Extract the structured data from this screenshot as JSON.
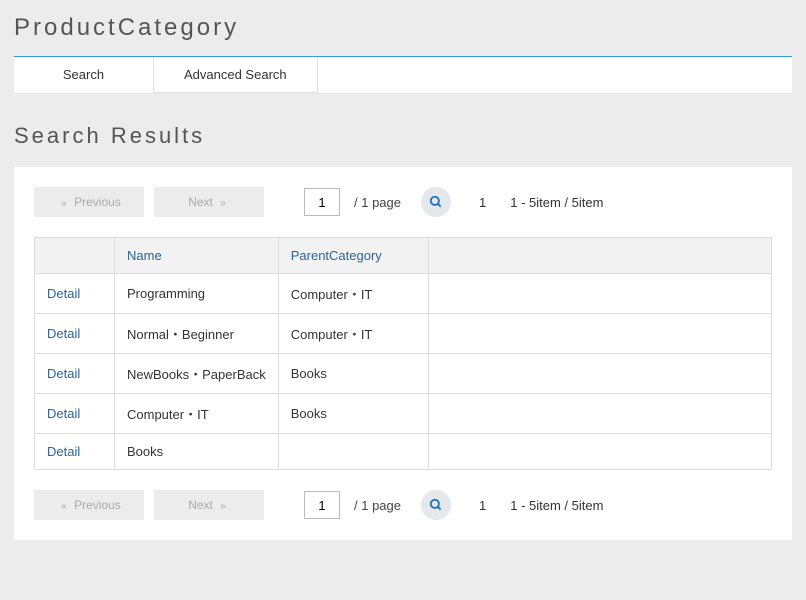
{
  "page": {
    "title": "ProductCategory",
    "results_title": "Search Results"
  },
  "tabs": {
    "search": "Search",
    "advanced": "Advanced Search"
  },
  "pagination": {
    "previous": "Previous",
    "next": "Next",
    "page_value": "1",
    "page_total": "/  1 page",
    "current_page": "1",
    "range": "1 - 5item / 5item"
  },
  "table": {
    "headers": {
      "name": "Name",
      "parent": "ParentCategory"
    },
    "detail_label": "Detail",
    "rows": [
      {
        "name": "Programming",
        "parent": "Computer・IT"
      },
      {
        "name": "Normal・Beginner",
        "parent": "Computer・IT"
      },
      {
        "name": "NewBooks・PaperBack",
        "parent": "Books"
      },
      {
        "name": "Computer・IT",
        "parent": "Books"
      },
      {
        "name": "Books",
        "parent": ""
      }
    ]
  }
}
